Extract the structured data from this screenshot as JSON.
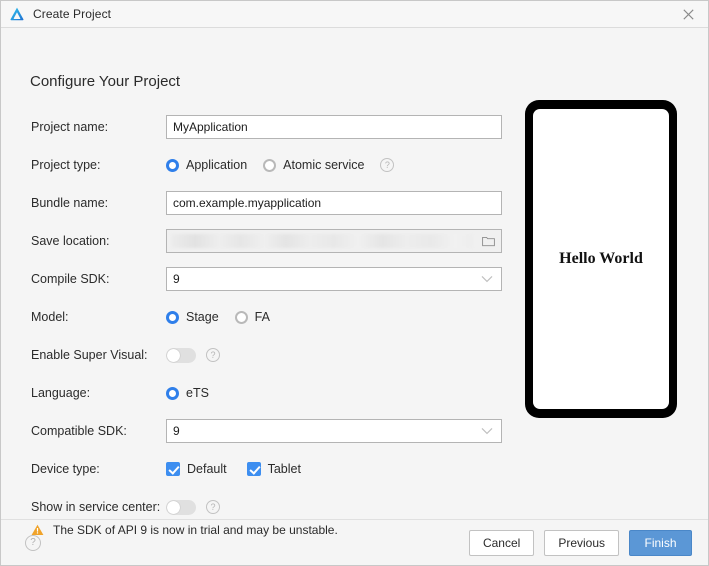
{
  "window": {
    "title": "Create Project",
    "app_icon": "deveco-logo-icon",
    "close_icon": "close-icon"
  },
  "page_title": "Configure Your Project",
  "form": {
    "project_name": {
      "label": "Project name:",
      "value": "MyApplication",
      "placeholder": ""
    },
    "project_type": {
      "label": "Project type:",
      "options": [
        "Application",
        "Atomic service"
      ],
      "selected": "Application",
      "help": "?"
    },
    "bundle_name": {
      "label": "Bundle name:",
      "value": "com.example.myapplication",
      "placeholder": ""
    },
    "save_location": {
      "label": "Save location:",
      "value": "",
      "placeholder": "",
      "browse_icon": "folder-icon"
    },
    "compile_sdk": {
      "label": "Compile SDK:",
      "value": "9",
      "options": [
        "9"
      ]
    },
    "model": {
      "label": "Model:",
      "options": [
        "Stage",
        "FA"
      ],
      "selected": "Stage"
    },
    "enable_super_visual": {
      "label": "Enable Super Visual:",
      "state": "off",
      "help": "?"
    },
    "language": {
      "label": "Language:",
      "options": [
        "eTS"
      ],
      "selected": "eTS"
    },
    "compatible_sdk": {
      "label": "Compatible SDK:",
      "value": "9",
      "options": [
        "9"
      ]
    },
    "device_type": {
      "label": "Device type:",
      "options": [
        {
          "label": "Default",
          "checked": true
        },
        {
          "label": "Tablet",
          "checked": true
        }
      ]
    },
    "show_in_service_center": {
      "label": "Show in service center:",
      "state": "off",
      "help": "?"
    }
  },
  "warning": {
    "icon": "warning-triangle-icon",
    "text": "The SDK of API 9 is now in trial and may be unstable."
  },
  "preview": {
    "screen_text": "Hello World"
  },
  "footer": {
    "help": "?",
    "cancel": "Cancel",
    "previous": "Previous",
    "finish": "Finish"
  },
  "colors": {
    "accent_blue": "#3d8ef0",
    "primary_button": "#5b97d6",
    "warning_amber": "#f0a32a",
    "window_bg": "#f5f5f5"
  }
}
